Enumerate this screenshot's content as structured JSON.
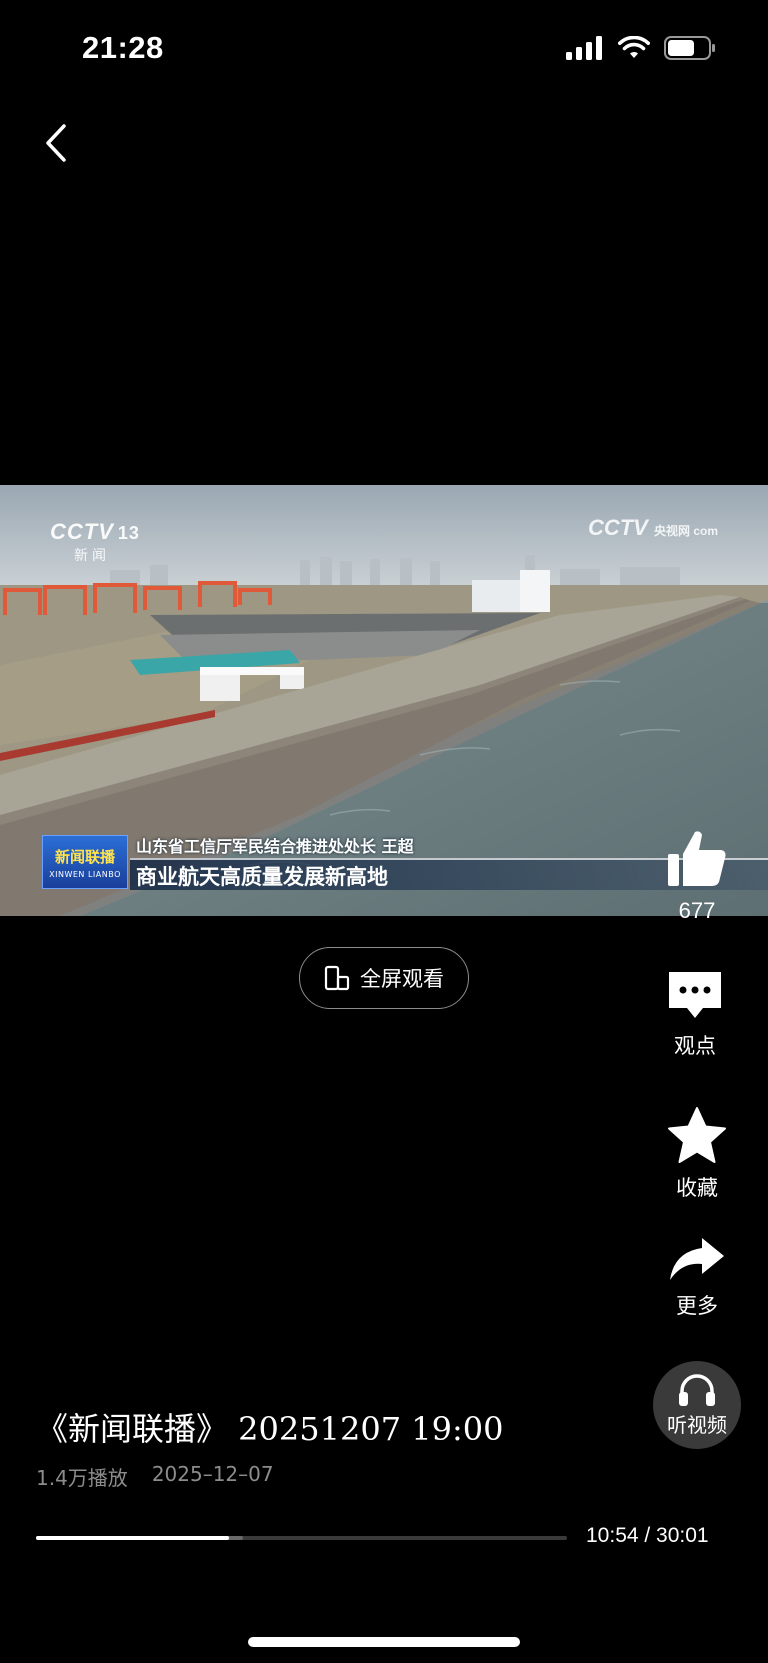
{
  "status": {
    "time": "21:28"
  },
  "video": {
    "logo_left": "CCTV",
    "logo_left_channel": "13",
    "logo_left_sub": "新闻",
    "logo_right": "CCTV",
    "logo_right_small": "央视网 com",
    "badge_cn": "新闻联播",
    "badge_en": "XINWEN LIANBO",
    "caption_top": "山东省工信厅军民结合推进处处长 王超",
    "caption_main": "商业航天高质量发展新高地"
  },
  "fullscreen": {
    "label": "全屏观看"
  },
  "actions": {
    "like_count": "677",
    "comment_label": "观点",
    "favorite_label": "收藏",
    "more_label": "更多",
    "listen_label": "听视频"
  },
  "info": {
    "title": "《新闻联播》 20251207  19:00",
    "plays": "1.4万播放",
    "date": "2025–12–07"
  },
  "player": {
    "current": "10:54",
    "total": "30:01",
    "time_display": "10:54 / 30:01",
    "progress_fraction": 0.363,
    "buffered_fraction": 0.39
  },
  "icons": [
    "back-icon",
    "signal-icon",
    "wifi-icon",
    "battery-icon",
    "fullscreen-phone-icon",
    "thumbs-up-icon",
    "comment-icon",
    "star-icon",
    "share-icon",
    "headphones-icon"
  ]
}
